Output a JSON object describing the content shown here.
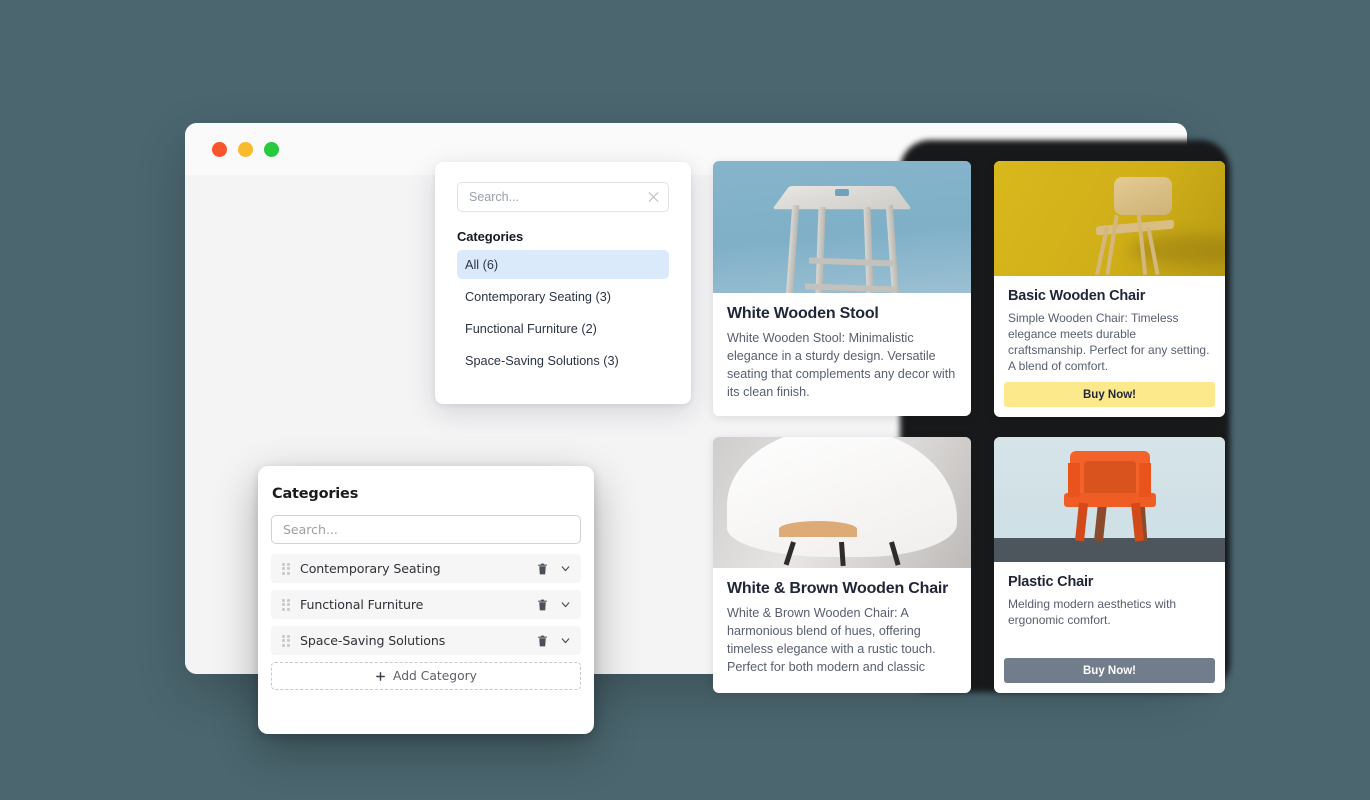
{
  "window": {
    "traffic_lights": [
      "close",
      "minimize",
      "maximize"
    ],
    "reload_icon": "reload-icon"
  },
  "dropdown": {
    "search": {
      "placeholder": "Search...",
      "value": "",
      "clear_icon": "close-icon"
    },
    "heading": "Categories",
    "items": [
      {
        "label": "All (6)",
        "active": true
      },
      {
        "label": "Contemporary Seating (3)",
        "active": false
      },
      {
        "label": "Functional Furniture (2)",
        "active": false
      },
      {
        "label": "Space-Saving Solutions (3)",
        "active": false
      }
    ]
  },
  "category_editor": {
    "title": "Categories",
    "search": {
      "placeholder": "Search...",
      "value": ""
    },
    "rows": [
      {
        "label": "Contemporary Seating",
        "delete_icon": "trash-icon",
        "expand_icon": "chevron-down-icon"
      },
      {
        "label": "Functional Furniture",
        "delete_icon": "trash-icon",
        "expand_icon": "chevron-down-icon"
      },
      {
        "label": "Space-Saving Solutions",
        "delete_icon": "trash-icon",
        "expand_icon": "chevron-down-icon"
      }
    ],
    "add_button": {
      "label": "Add Category",
      "icon": "plus-icon"
    }
  },
  "products": [
    {
      "title": "White Wooden Stool",
      "description": "White Wooden Stool: Minimalistic elegance in a sturdy design. Versatile seating that complements any decor with its clean finish.",
      "image_bg": "#86b4cb",
      "buy_button": null
    },
    {
      "title": "Basic Wooden Chair",
      "description": "Simple Wooden Chair: Timeless elegance meets durable craftsmanship. Perfect for any setting. A blend of comfort.",
      "image_bg": "#d9b81d",
      "buy_button": {
        "label": "Buy Now!",
        "bg": "#fbe98c",
        "color": "#1f2638"
      }
    },
    {
      "title": "White & Brown Wooden Chair",
      "description": "White & Brown Wooden Chair: A harmonious blend of hues, offering timeless elegance with a rustic touch. Perfect for both modern and classic",
      "image_bg": "#d8d6d4",
      "buy_button": null
    },
    {
      "title": "Plastic Chair",
      "description": "Melding modern aesthetics with ergonomic comfort.",
      "image_bg": "#cfe0e6",
      "buy_button": {
        "label": "Buy Now!",
        "bg": "#717d8a",
        "color": "#ffffff"
      }
    }
  ],
  "colors": {
    "page_background": "#4b666f",
    "window_body": "#f4f4f5",
    "titlebar": "#fafafa",
    "accent_selected": "#dbeafb",
    "traffic_red": "#f9542b",
    "traffic_yellow": "#f9bb2e",
    "traffic_green": "#27c93f"
  }
}
